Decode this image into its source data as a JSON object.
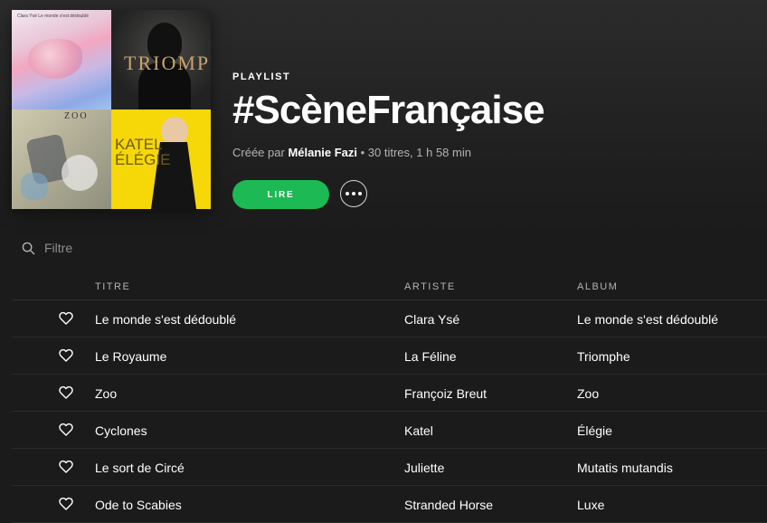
{
  "cover": {
    "tiles": [
      {
        "name": "Le monde s'est dédoublé",
        "tiny_text": "Clara Ysé Le monde s'est dédoublé"
      },
      {
        "name": "Triomphe",
        "title_text": "TRIOMPHE"
      },
      {
        "name": "Zoo",
        "title_text": "ZOO"
      },
      {
        "name": "Élégie",
        "title_text": "KATEL ÉLÉGIE"
      }
    ]
  },
  "playlist": {
    "kind_label": "PLAYLIST",
    "title": "#ScèneFrançaise",
    "created_by_prefix": "Créée par",
    "owner": "Mélanie Fazi",
    "stats": " • 30 titres, 1 h 58 min"
  },
  "controls": {
    "play_label": "LIRE",
    "more_icon": "ellipsis-icon"
  },
  "filter": {
    "placeholder": "Filtre",
    "value": ""
  },
  "table": {
    "headers": {
      "title": "TITRE",
      "artist": "ARTISTE",
      "album": "ALBUM"
    },
    "rows": [
      {
        "title": "Le monde s'est dédoublé",
        "artist": "Clara Ysé",
        "album": "Le monde s'est dédoublé"
      },
      {
        "title": "Le Royaume",
        "artist": "La Féline",
        "album": "Triomphe"
      },
      {
        "title": "Zoo",
        "artist": "Françoiz Breut",
        "album": "Zoo"
      },
      {
        "title": "Cyclones",
        "artist": "Katel",
        "album": "Élégie"
      },
      {
        "title": "Le sort de Circé",
        "artist": "Juliette",
        "album": "Mutatis mutandis"
      },
      {
        "title": "Ode to Scabies",
        "artist": "Stranded Horse",
        "album": "Luxe"
      }
    ]
  },
  "colors": {
    "accent": "#1db954",
    "background": "#1b1b1b",
    "muted_text": "#b3b3b3"
  }
}
